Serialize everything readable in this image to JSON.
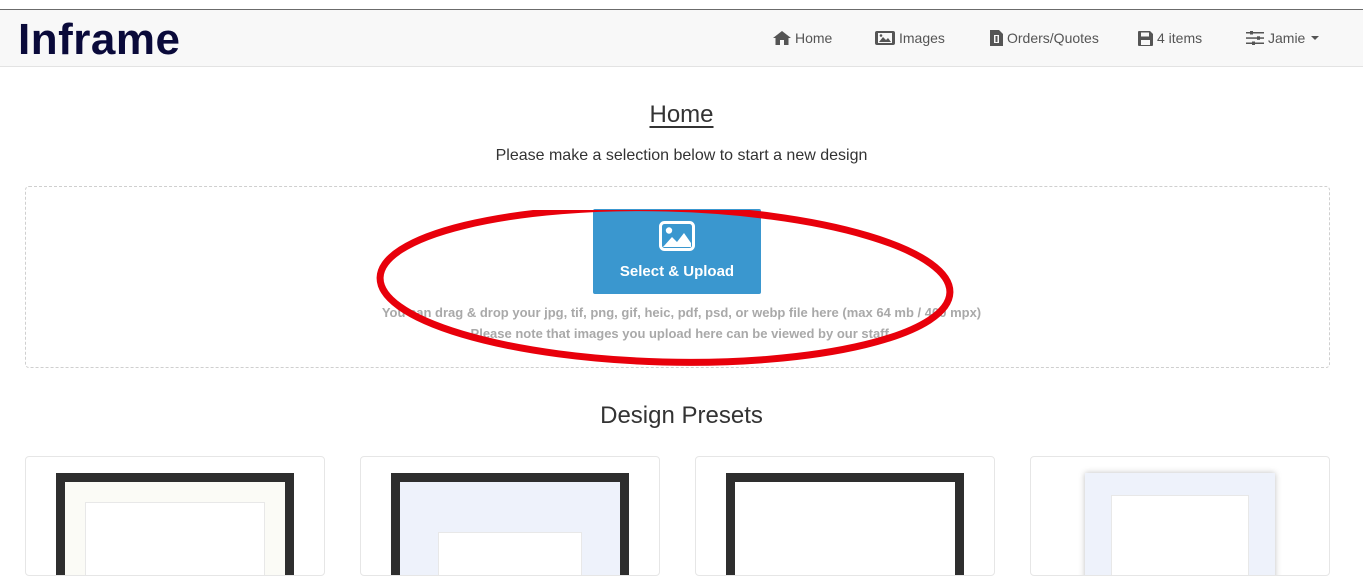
{
  "brand": "Inframe",
  "nav": {
    "home": "Home",
    "images": "Images",
    "orders": "Orders/Quotes",
    "cart": "4 items",
    "user": "Jamie"
  },
  "page": {
    "title": "Home",
    "subtitle": "Please make a selection below to start a new design"
  },
  "upload": {
    "button_label": "Select & Upload",
    "hint_line1": "You can drag & drop your jpg, tif, png, gif, heic, pdf, psd, or webp file here (max 64 mb / 400 mpx)",
    "hint_line2": "Please note that images you upload here can be viewed by our staff."
  },
  "presets": {
    "title": "Design Presets",
    "cards": [
      "preset-1",
      "preset-2",
      "preset-3",
      "preset-4"
    ]
  },
  "colors": {
    "accent": "#3a97cf",
    "annotation": "#e8000b",
    "brand": "#0a0a3a"
  },
  "icons": [
    "home-icon",
    "images-icon",
    "orders-icon",
    "save-icon",
    "sliders-icon",
    "image-icon"
  ]
}
